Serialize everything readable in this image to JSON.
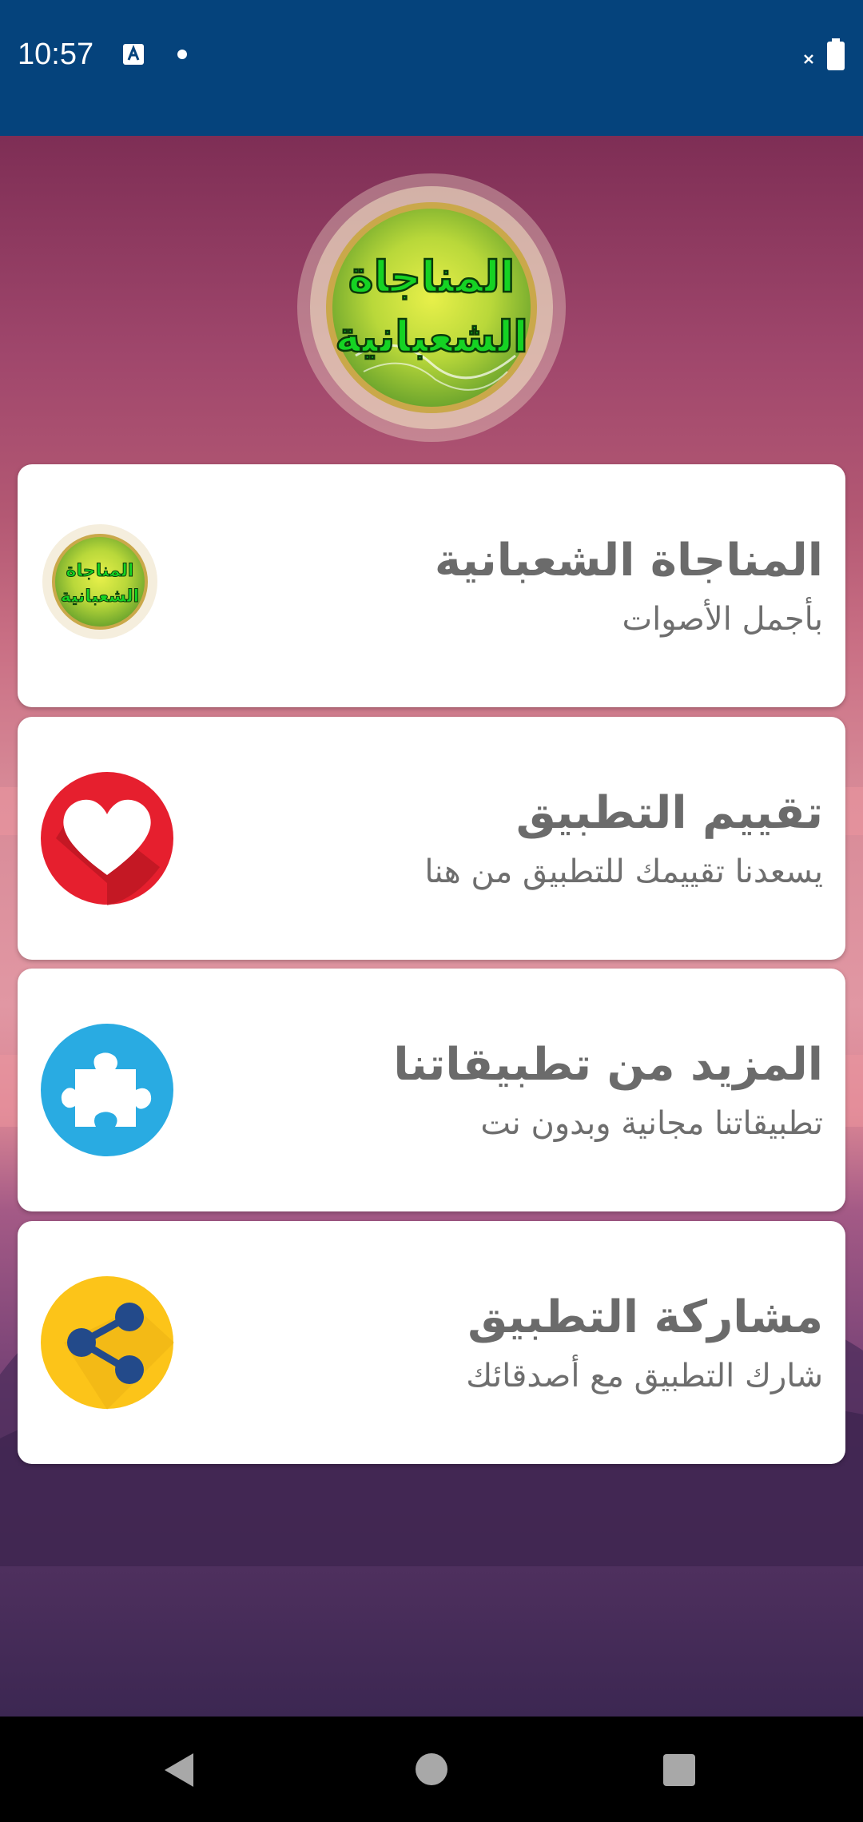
{
  "status_bar": {
    "time": "10:57",
    "icons": [
      "accessibility-a-icon",
      "notification-dot-icon",
      "no-signal-x-icon",
      "battery-icon"
    ],
    "background": "#05437c"
  },
  "header": {
    "logo_icon": "app-logo-medallion",
    "logo_text_line1": "المناجاة",
    "logo_text_line2": "الشعبانية"
  },
  "cards": [
    {
      "title": "المناجاة الشعبانية",
      "subtitle": "بأجمل الأصوات",
      "icon": "app-logo-icon"
    },
    {
      "title": "تقييم التطبيق",
      "subtitle": "يسعدنا تقييمك للتطبيق من هنا",
      "icon": "heart-icon",
      "icon_color": "#e61f2e"
    },
    {
      "title": "المزيد من تطبيقاتنا",
      "subtitle": "تطبيقاتنا مجانية وبدون نت",
      "icon": "puzzle-icon",
      "icon_color": "#29abe2"
    },
    {
      "title": "مشاركة التطبيق",
      "subtitle": "شارك التطبيق مع أصدقائك",
      "icon": "share-icon",
      "icon_color": "#fcc419"
    }
  ],
  "nav_bar": {
    "buttons": [
      "back-icon",
      "home-icon",
      "recents-icon"
    ]
  }
}
